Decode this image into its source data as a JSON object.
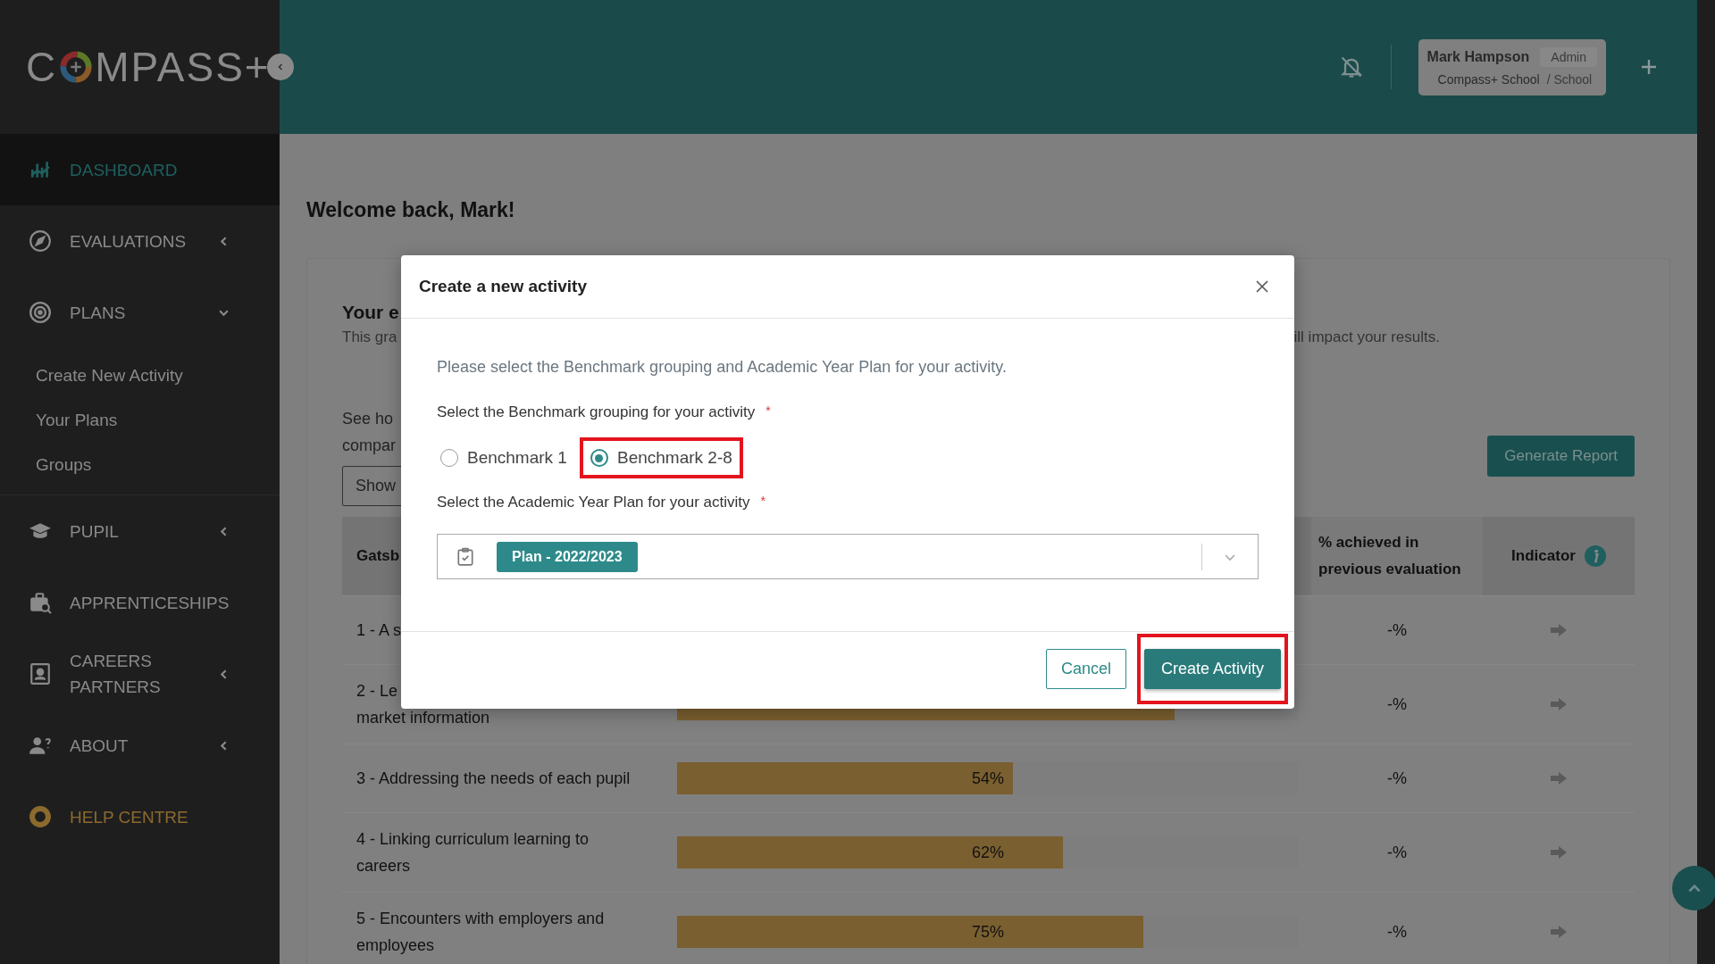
{
  "logo": {
    "before": "C",
    "after": "MPASS+"
  },
  "sidebar": {
    "items": [
      {
        "label": "DASHBOARD",
        "kind": "link",
        "selected": true
      },
      {
        "label": "EVALUATIONS",
        "kind": "group",
        "selected": false,
        "expanded": false
      },
      {
        "label": "PLANS",
        "kind": "group",
        "selected": false,
        "expanded": true,
        "children": [
          {
            "label": "Create New Activity"
          },
          {
            "label": "Your Plans"
          },
          {
            "label": "Groups"
          }
        ]
      },
      {
        "label": "PUPIL",
        "kind": "group",
        "selected": false,
        "expanded": false
      },
      {
        "label": "APPRENTICESHIPS",
        "kind": "link",
        "selected": false
      },
      {
        "label": "CAREERS PARTNERS",
        "kind": "group",
        "selected": false,
        "expanded": false
      },
      {
        "label": "ABOUT",
        "kind": "group",
        "selected": false,
        "expanded": false
      },
      {
        "label": "HELP CENTRE",
        "kind": "link",
        "selected": false,
        "color": "#8c6a2e"
      }
    ]
  },
  "header": {
    "user": {
      "name": "Mark Hampson",
      "role": "Admin",
      "school": "Compass+ School",
      "type": "/ School"
    }
  },
  "content": {
    "welcome": "Welcome back, Mark!",
    "card": {
      "title": "Your e",
      "text_left": "This gra",
      "text_right": "ill impact your results.",
      "see_line_1": "See ho",
      "see_line_2": "compar",
      "show_button": "Show",
      "generate_button": "Generate Report"
    },
    "table": {
      "columns": [
        "Gatsb",
        "% achieved in previous evaluation",
        "Indicator"
      ],
      "rows": [
        {
          "benchmark": "1 - A s",
          "previous": "-%"
        },
        {
          "benchmark": "2 - Le",
          "benchmark_line_2": "market information",
          "level": 0.8,
          "previous": "-%"
        },
        {
          "benchmark": "3 - Addressing the needs of each pupil",
          "level": 0.54,
          "value": "54%",
          "previous": "-%"
        },
        {
          "benchmark": "4 - Linking curriculum learning to careers",
          "level": 0.62,
          "value": "62%",
          "previous": "-%"
        },
        {
          "benchmark": "5 - Encounters with employers and employees",
          "level": 0.75,
          "value": "75%",
          "previous": "-%"
        }
      ]
    }
  },
  "modal": {
    "title": "Create a new activity",
    "intro": "Please select the Benchmark grouping and Academic Year Plan for your activity.",
    "grouping_label": "Select the Benchmark grouping for your activity",
    "required_mark": "*",
    "options": [
      {
        "label": "Benchmark 1",
        "selected": false,
        "highlighted": false
      },
      {
        "label": "Benchmark 2-8",
        "selected": true,
        "highlighted": true
      }
    ],
    "plan_label": "Select the Academic Year Plan for your activity",
    "plan_required_mark": "*",
    "plan_value": "Plan - 2022/2023",
    "buttons": [
      {
        "label": "Cancel",
        "kind": "secondary",
        "highlighted": false
      },
      {
        "label": "Create Activity",
        "kind": "primary",
        "highlighted": true
      }
    ]
  }
}
